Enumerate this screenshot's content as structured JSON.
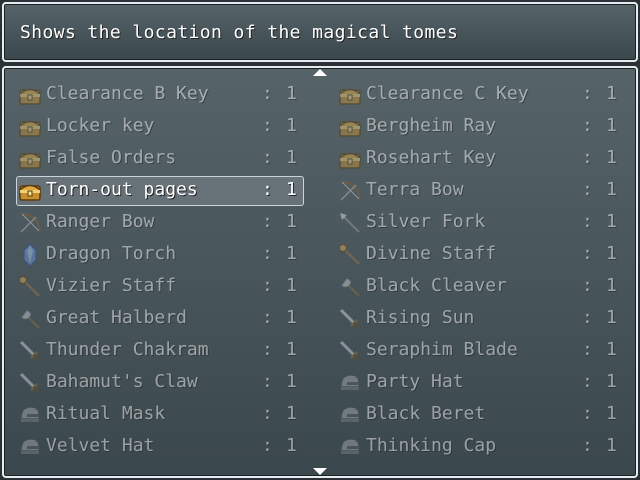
{
  "help": {
    "text": "Shows the location of the magical tomes"
  },
  "colors": {
    "window_border": "#e6ecee",
    "text": "#ffffff"
  },
  "items": [
    {
      "name": "Clearance B Key",
      "colon": ":",
      "qty": "1",
      "icon": "treasure-chest-icon",
      "selected": false
    },
    {
      "name": "Clearance C Key",
      "colon": ":",
      "qty": "1",
      "icon": "treasure-chest-icon",
      "selected": false
    },
    {
      "name": "Locker key",
      "colon": ":",
      "qty": "1",
      "icon": "treasure-chest-icon",
      "selected": false
    },
    {
      "name": "Bergheim Ray",
      "colon": ":",
      "qty": "1",
      "icon": "treasure-chest-icon",
      "selected": false
    },
    {
      "name": "False Orders",
      "colon": ":",
      "qty": "1",
      "icon": "treasure-chest-icon",
      "selected": false
    },
    {
      "name": "Rosehart Key",
      "colon": ":",
      "qty": "1",
      "icon": "treasure-chest-icon",
      "selected": false
    },
    {
      "name": "Torn-out pages",
      "colon": ":",
      "qty": "1",
      "icon": "treasure-chest-icon",
      "selected": true
    },
    {
      "name": "Terra Bow",
      "colon": ":",
      "qty": "1",
      "icon": "bow-icon",
      "selected": false
    },
    {
      "name": "Ranger Bow",
      "colon": ":",
      "qty": "1",
      "icon": "bow-icon",
      "selected": false
    },
    {
      "name": "Silver Fork",
      "colon": ":",
      "qty": "1",
      "icon": "spear-icon",
      "selected": false
    },
    {
      "name": "Dragon Torch",
      "colon": ":",
      "qty": "1",
      "icon": "crystal-icon",
      "selected": false
    },
    {
      "name": "Divine Staff",
      "colon": ":",
      "qty": "1",
      "icon": "staff-icon",
      "selected": false
    },
    {
      "name": "Vizier Staff",
      "colon": ":",
      "qty": "1",
      "icon": "staff-icon",
      "selected": false
    },
    {
      "name": "Black Cleaver",
      "colon": ":",
      "qty": "1",
      "icon": "axe-icon",
      "selected": false
    },
    {
      "name": "Great Halberd",
      "colon": ":",
      "qty": "1",
      "icon": "axe-icon",
      "selected": false
    },
    {
      "name": "Rising Sun",
      "colon": ":",
      "qty": "1",
      "icon": "sword-icon",
      "selected": false
    },
    {
      "name": "Thunder Chakram",
      "colon": ":",
      "qty": "1",
      "icon": "sword-icon",
      "selected": false
    },
    {
      "name": "Seraphim Blade",
      "colon": ":",
      "qty": "1",
      "icon": "sword-icon",
      "selected": false
    },
    {
      "name": "Bahamut's Claw",
      "colon": ":",
      "qty": "1",
      "icon": "sword-icon",
      "selected": false
    },
    {
      "name": "Party Hat",
      "colon": ":",
      "qty": "1",
      "icon": "helmet-icon",
      "selected": false
    },
    {
      "name": "Ritual Mask",
      "colon": ":",
      "qty": "1",
      "icon": "helmet-icon",
      "selected": false
    },
    {
      "name": "Black Beret",
      "colon": ":",
      "qty": "1",
      "icon": "helmet-icon",
      "selected": false
    },
    {
      "name": "Velvet Hat",
      "colon": ":",
      "qty": "1",
      "icon": "helmet-icon",
      "selected": false
    },
    {
      "name": "Thinking Cap",
      "colon": ":",
      "qty": "1",
      "icon": "helmet-icon",
      "selected": false
    }
  ]
}
